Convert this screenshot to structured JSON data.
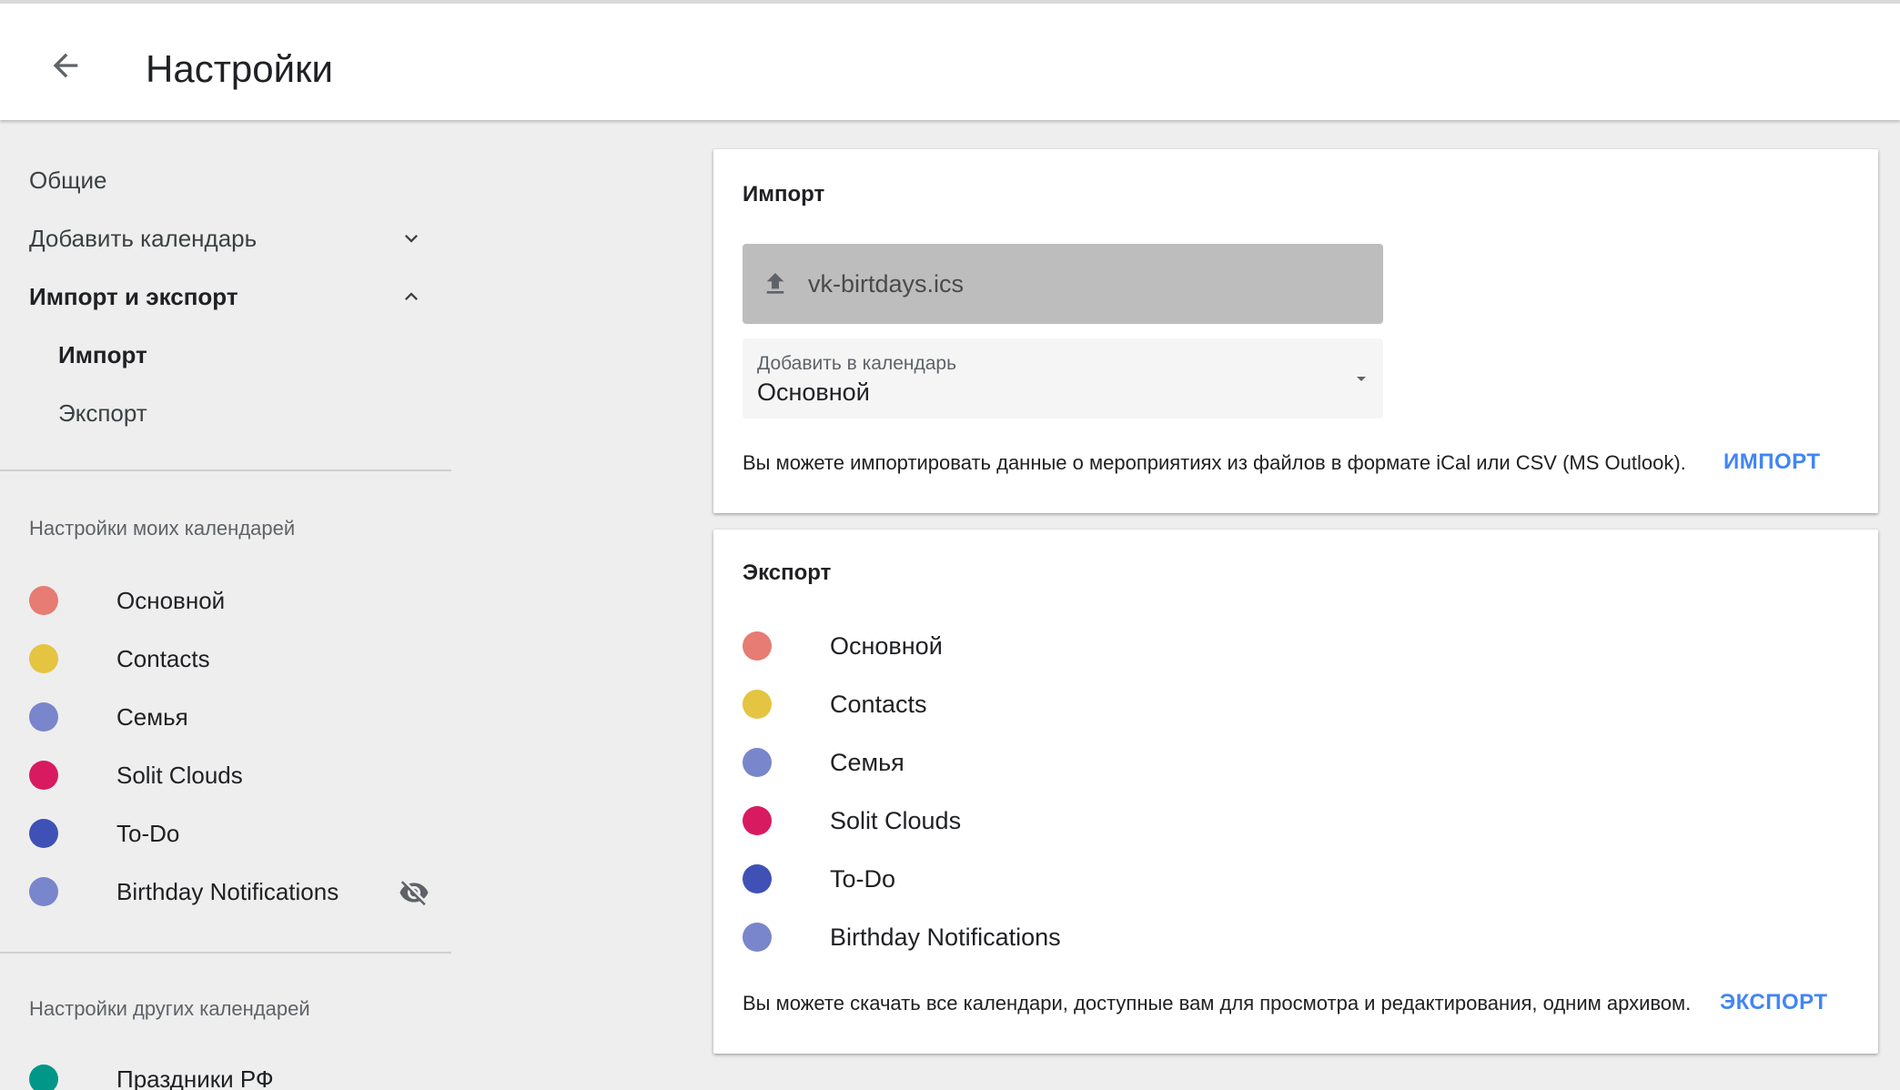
{
  "header": {
    "back_icon": "arrow-left-icon",
    "title": "Настройки"
  },
  "sidebar": {
    "nav": {
      "general": "Общие",
      "add_calendar": "Добавить календарь",
      "import_export": "Импорт и экспорт",
      "import": "Импорт",
      "export": "Экспорт"
    },
    "my_calendars_label": "Настройки моих календарей",
    "my_calendars": [
      {
        "name": "Основной",
        "color": "#e67c73"
      },
      {
        "name": "Contacts",
        "color": "#e4c441"
      },
      {
        "name": "Семья",
        "color": "#7986cb"
      },
      {
        "name": "Solit Clouds",
        "color": "#d81b60"
      },
      {
        "name": "To-Do",
        "color": "#3f51b5"
      },
      {
        "name": "Birthday Notifications",
        "color": "#7986cb",
        "hidden_icon": "eye-off-icon"
      }
    ],
    "other_calendars_label": "Настройки других календарей",
    "other_calendars": [
      {
        "name": "Праздники РФ",
        "color": "#009688"
      }
    ]
  },
  "import_card": {
    "title": "Импорт",
    "file_name": "vk-birtdays.ics",
    "select_label": "Добавить в календарь",
    "select_value": "Основной",
    "description": "Вы можете импортировать данные о мероприятиях из файлов в формате iCal или CSV (MS Outlook).",
    "action": "ИМПОРТ"
  },
  "export_card": {
    "title": "Экспорт",
    "calendars": [
      {
        "name": "Основной",
        "color": "#e67c73"
      },
      {
        "name": "Contacts",
        "color": "#e4c441"
      },
      {
        "name": "Семья",
        "color": "#7986cb"
      },
      {
        "name": "Solit Clouds",
        "color": "#d81b60"
      },
      {
        "name": "To-Do",
        "color": "#3f51b5"
      },
      {
        "name": "Birthday Notifications",
        "color": "#7986cb"
      }
    ],
    "description": "Вы можете скачать все календари, доступные вам для просмотра и редактирования, одним архивом.",
    "action": "ЭКСПОРТ"
  }
}
